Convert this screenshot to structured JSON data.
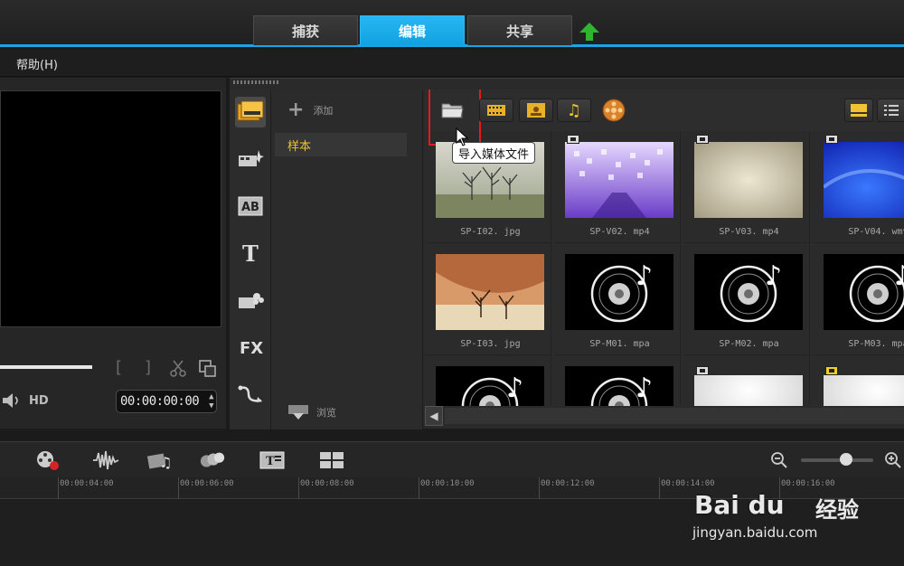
{
  "top_tabs": [
    "捕获",
    "编辑",
    "共享"
  ],
  "menu": {
    "help": "帮助(H)"
  },
  "preview": {
    "timecode": "00:00:00:00",
    "hd": "HD"
  },
  "library": {
    "add_label": "添加",
    "folder": "样本",
    "browse_label": "浏览",
    "tooltip": "导入媒体文件"
  },
  "media": [
    {
      "name": "SP-I02. jpg",
      "kind": "image-tree"
    },
    {
      "name": "SP-V02. mp4",
      "kind": "video-purple"
    },
    {
      "name": "SP-V03. mp4",
      "kind": "video-beige"
    },
    {
      "name": "SP-V04. wmv",
      "kind": "video-blue"
    },
    {
      "name": "SP-I03. jpg",
      "kind": "image-desert"
    },
    {
      "name": "SP-M01. mpa",
      "kind": "audio"
    },
    {
      "name": "SP-M02. mpa",
      "kind": "audio"
    },
    {
      "name": "SP-M03. mpa",
      "kind": "audio"
    },
    {
      "name": "",
      "kind": "audio"
    },
    {
      "name": "",
      "kind": "audio"
    },
    {
      "name": "",
      "kind": "video-white"
    },
    {
      "name": "",
      "kind": "video-white"
    }
  ],
  "timeline": {
    "ticks": [
      "00:00:04:00",
      "00:00:06:00",
      "00:00:08:00",
      "00:00:10:00",
      "00:00:12:00",
      "00:00:14:00",
      "00:00:16:00"
    ]
  },
  "watermark": {
    "logo": "Bai du",
    "jingyan": "经验",
    "url": "jingyan.baidu.com"
  },
  "colors": {
    "accent": "#19a6e6",
    "folder_text": "#f2c230",
    "highlight": "#e21b1b"
  }
}
